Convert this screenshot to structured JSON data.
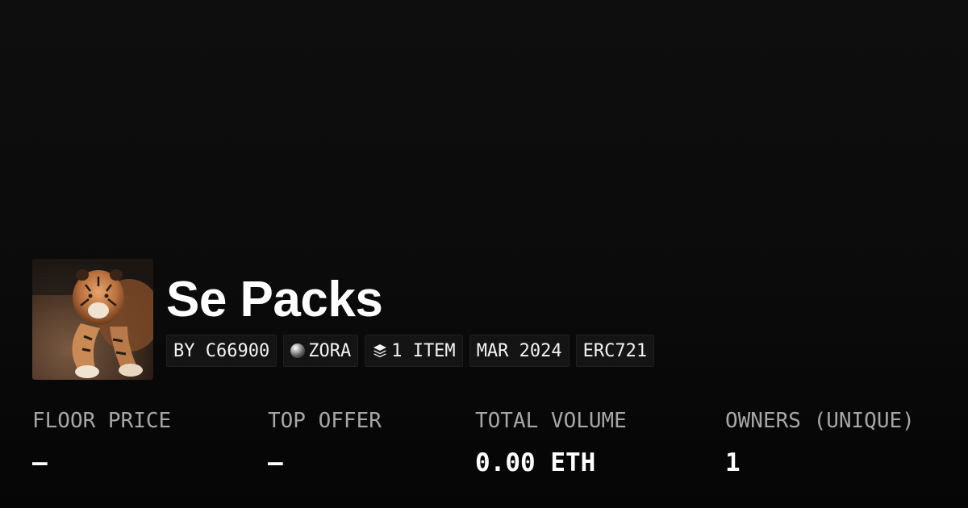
{
  "collection": {
    "name": "Se Packs",
    "thumbnail_icon": "tiger-photo",
    "tags": {
      "creator": "BY C66900",
      "chain": "ZORA",
      "chain_icon": "zora-orb-icon",
      "items": "1 ITEM",
      "items_icon": "layers-icon",
      "date": "MAR 2024",
      "standard": "ERC721"
    }
  },
  "stats": [
    {
      "label": "FLOOR PRICE",
      "value": "–"
    },
    {
      "label": "TOP OFFER",
      "value": "–"
    },
    {
      "label": "TOTAL VOLUME",
      "value": "0.00 ETH"
    },
    {
      "label": "OWNERS (UNIQUE)",
      "value": "1"
    }
  ],
  "colors": {
    "background": "#0b0b0b",
    "text": "#ffffff",
    "muted": "#a6a6a6",
    "tag_bg": "#141414"
  }
}
